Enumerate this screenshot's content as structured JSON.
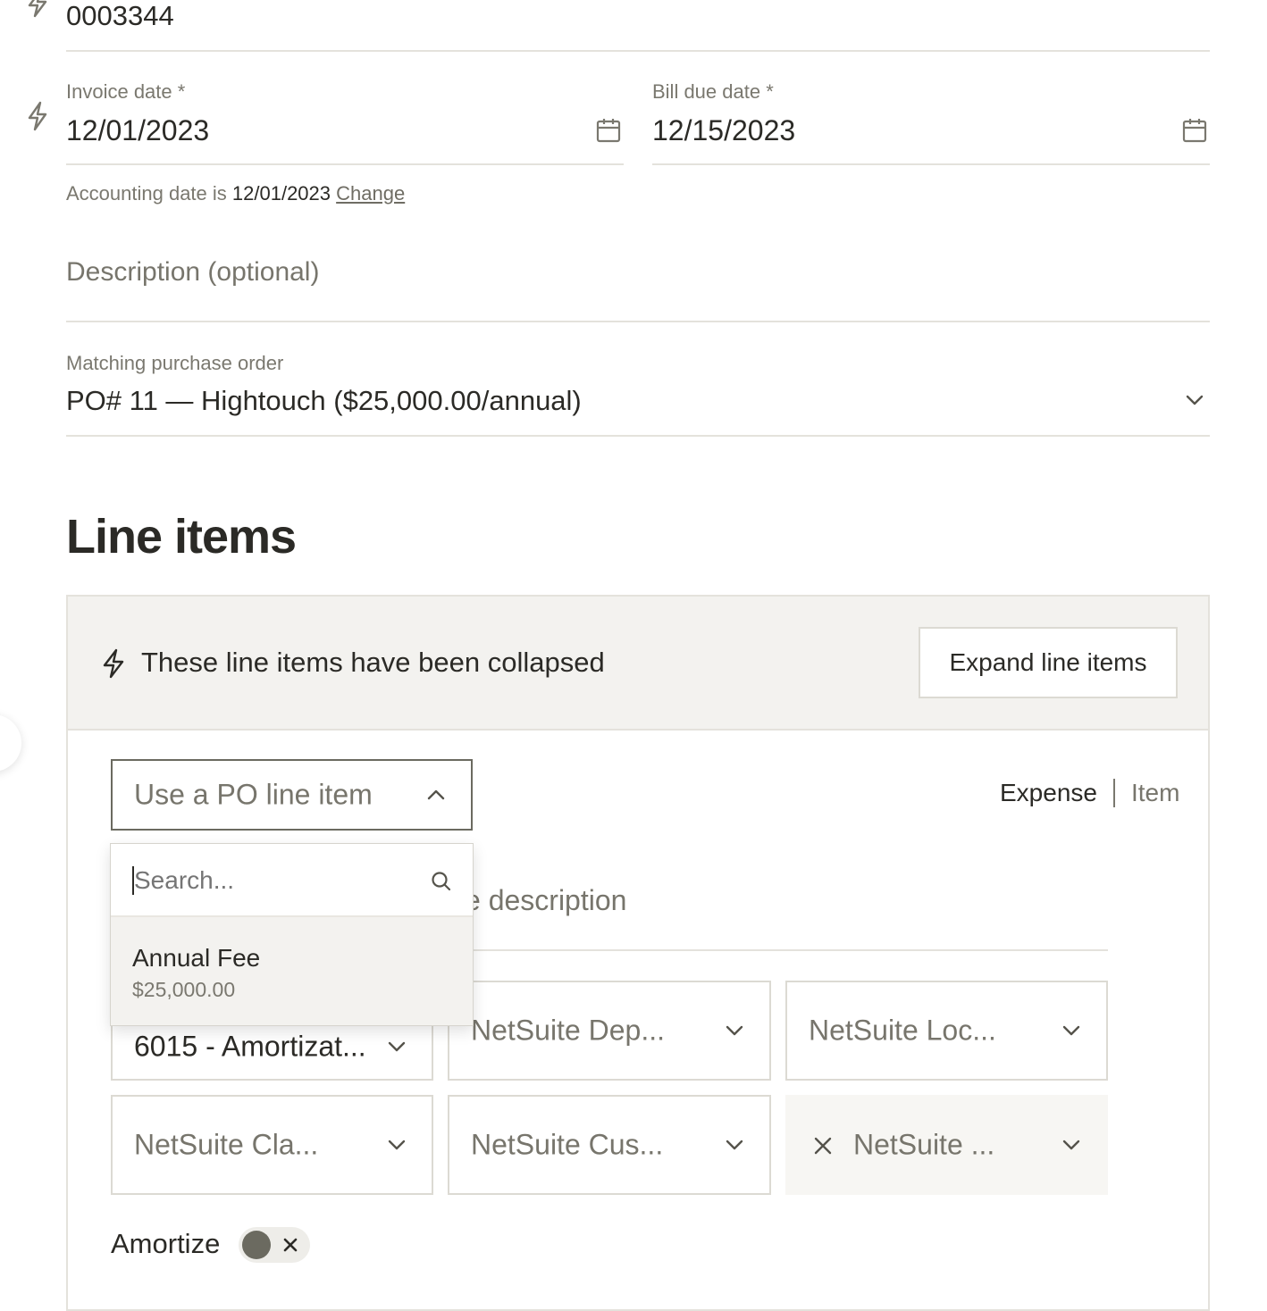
{
  "invoice_number": {
    "value": "0003344"
  },
  "invoice_date": {
    "label": "Invoice date *",
    "value": "12/01/2023"
  },
  "bill_due_date": {
    "label": "Bill due date *",
    "value": "12/15/2023"
  },
  "accounting": {
    "prefix": "Accounting date is",
    "date": "12/01/2023",
    "change_label": "Change"
  },
  "description": {
    "placeholder": "Description (optional)"
  },
  "purchase_order": {
    "label": "Matching purchase order",
    "value": "PO# 11 — Hightouch ($25,000.00/annual)"
  },
  "line_items": {
    "title": "Line items",
    "collapsed_notice": "These line items have been collapsed",
    "expand_label": "Expand line items",
    "po_select_placeholder": "Use a PO line item",
    "tabs": {
      "expense": "Expense",
      "item": "Item"
    },
    "description_placeholder_fragment": "e description",
    "dropdown": {
      "search_placeholder": "Search...",
      "options": [
        {
          "name": "Annual Fee",
          "amount": "$25,000.00"
        }
      ]
    },
    "fields": {
      "account": "6015 - Amortizat...",
      "department": "NetSuite Dep...",
      "location": "NetSuite Loc...",
      "class": "NetSuite Cla...",
      "customer": "NetSuite Cus...",
      "other": "NetSuite ..."
    },
    "amortize_label": "Amortize"
  },
  "colors": {
    "accent_text": "#2b2a26",
    "muted_text": "#7a786f",
    "panel_bg": "#f3f2ef",
    "border": "#dcdad3",
    "toggle_knob": "#6b6a60"
  }
}
